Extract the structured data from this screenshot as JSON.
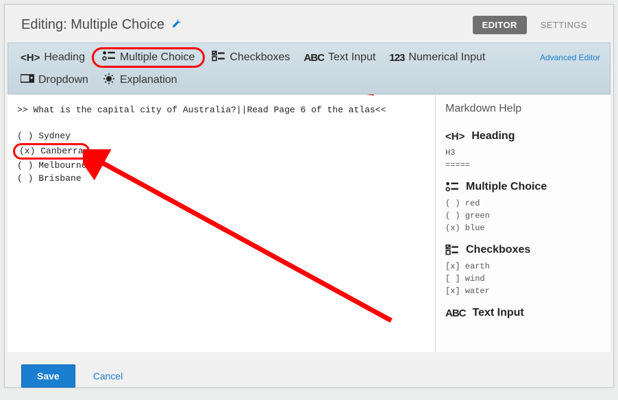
{
  "header": {
    "title": "Editing: Multiple Choice",
    "tab_editor": "EDITOR",
    "tab_settings": "SETTINGS"
  },
  "toolbar": {
    "heading": "Heading",
    "multiple_choice": "Multiple Choice",
    "checkboxes": "Checkboxes",
    "text_input": "Text Input",
    "numerical_input": "Numerical Input",
    "dropdown": "Dropdown",
    "explanation": "Explanation",
    "advanced_editor": "Advanced Editor"
  },
  "editor": {
    "prompt": ">> What is the capital city of Australia?||Read Page 6 of the atlas<<",
    "opt1": "( ) Sydney",
    "opt2": "(x) Canberra",
    "opt3": "( ) Melbourne",
    "opt4": "( ) Brisbane"
  },
  "sidebar": {
    "title": "Markdown Help",
    "heading": "Heading",
    "heading_ex": "H3\n=====",
    "mc": "Multiple Choice",
    "mc_ex": "( ) red\n( ) green\n(x) blue",
    "cb": "Checkboxes",
    "cb_ex": "[x] earth\n[ ] wind\n[x] water",
    "ti": "Text Input"
  },
  "footer": {
    "save": "Save",
    "cancel": "Cancel"
  }
}
